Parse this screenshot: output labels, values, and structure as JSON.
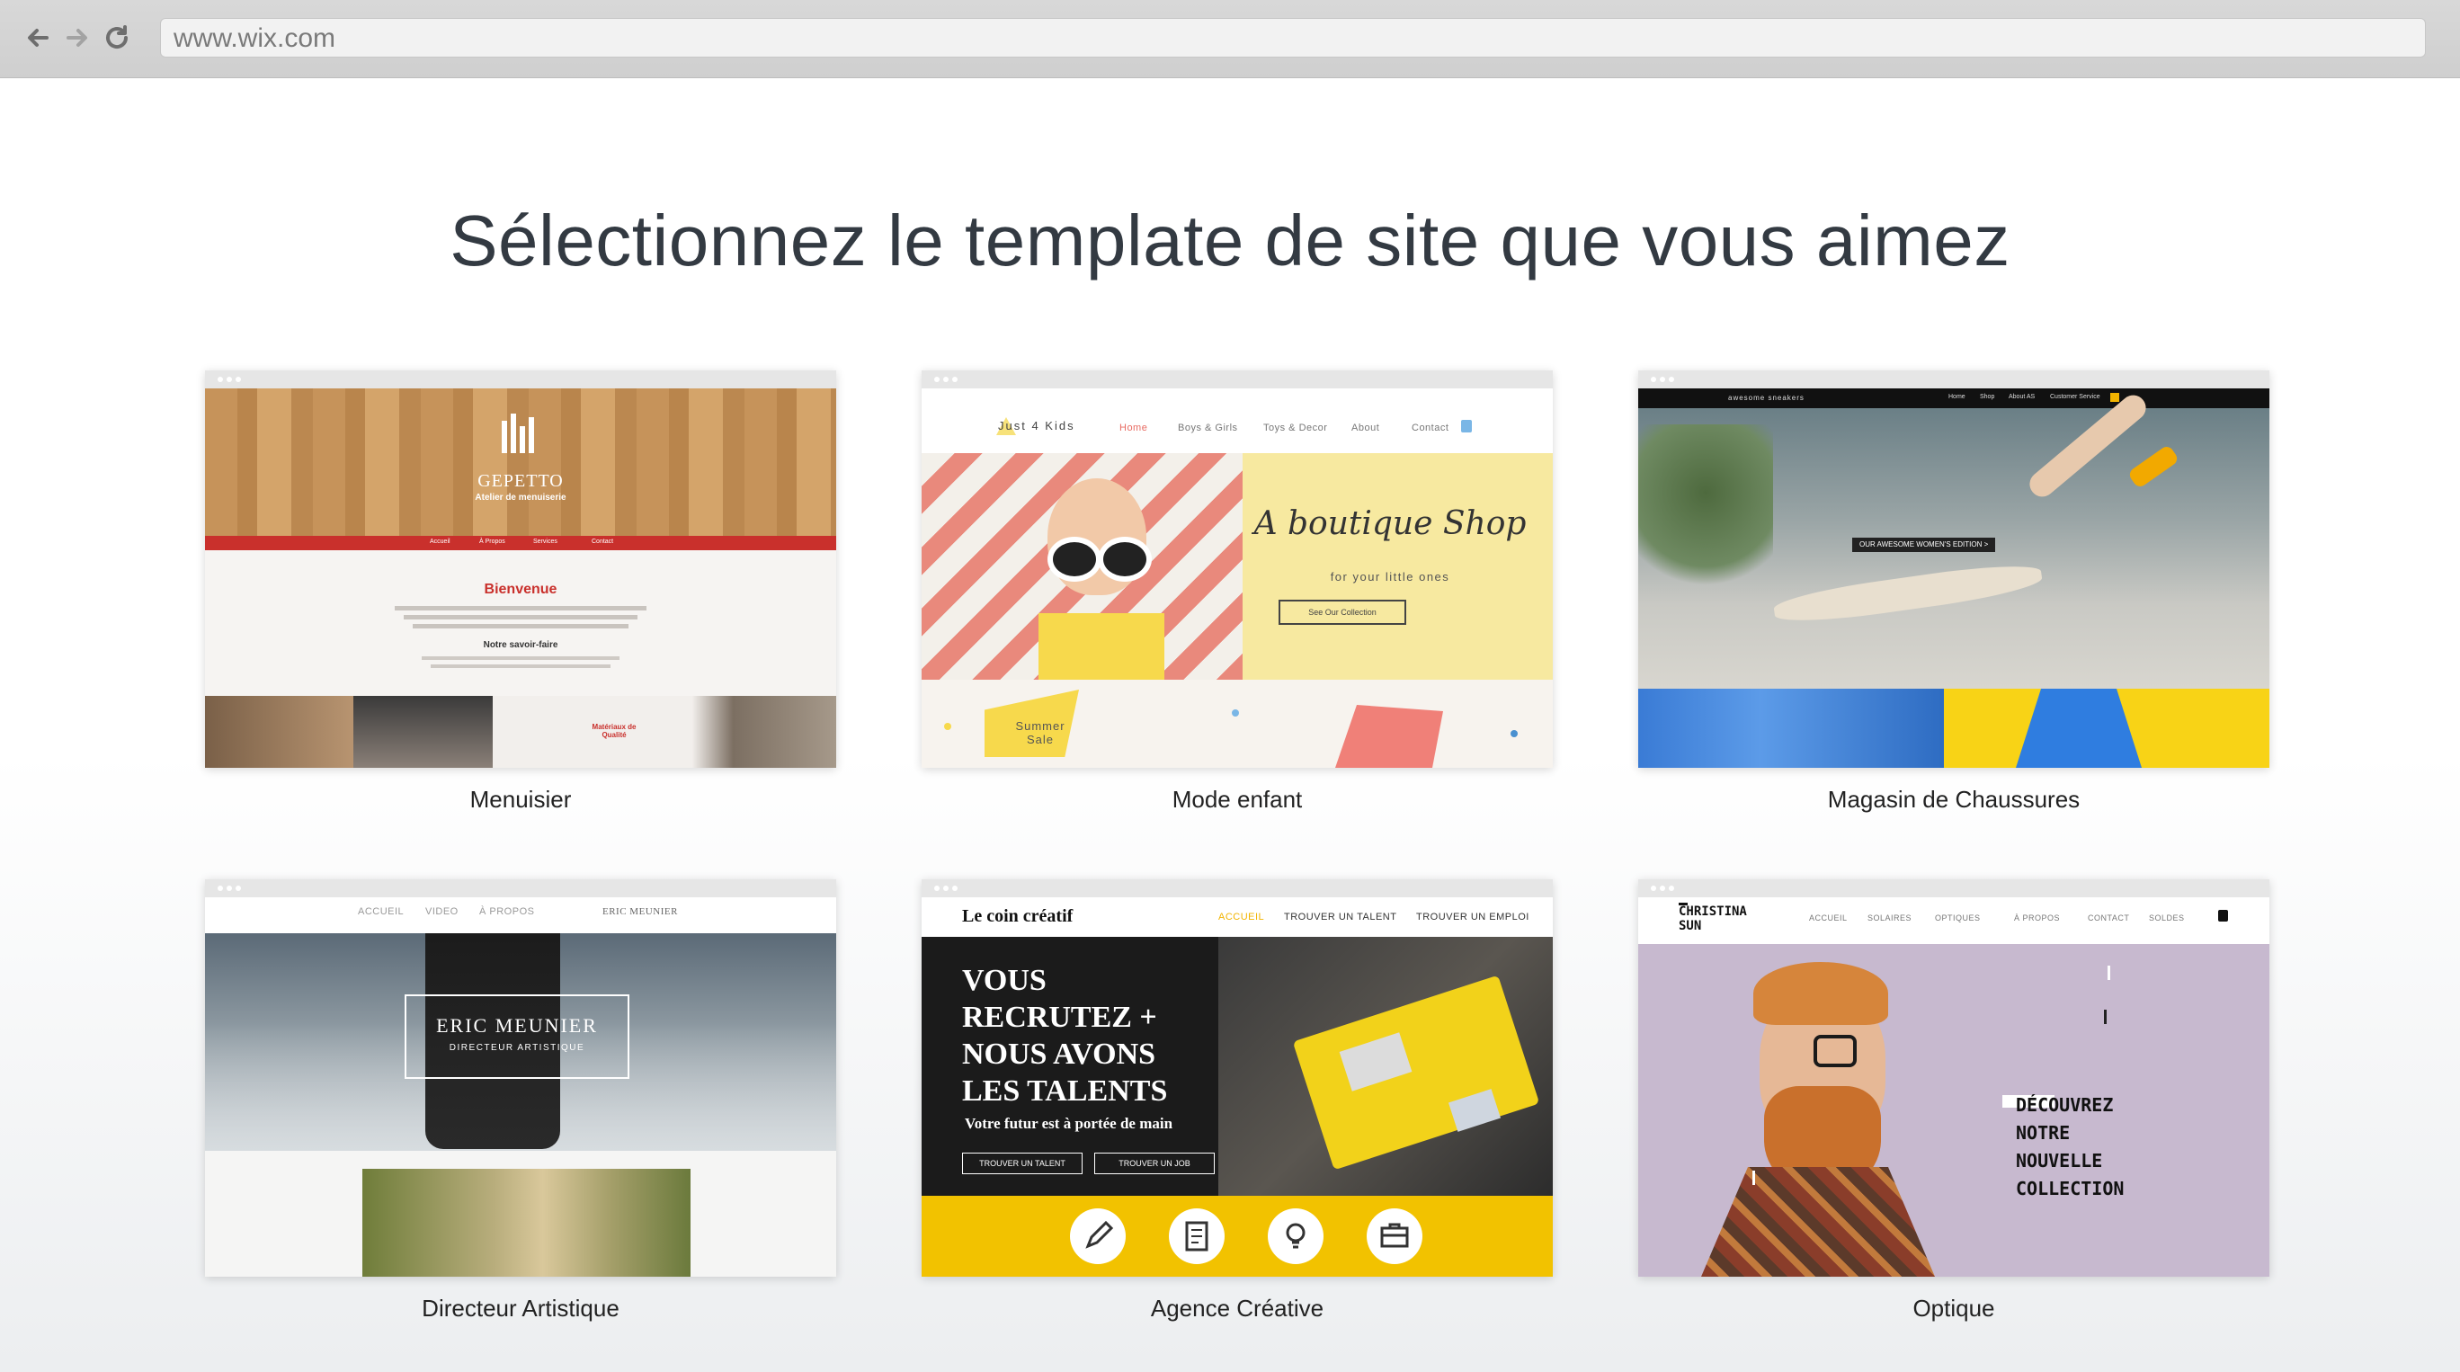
{
  "browser": {
    "url": "www.wix.com"
  },
  "page": {
    "title": "Sélectionnez le template de site que vous aimez"
  },
  "templates": [
    {
      "label": "Menuisier",
      "preview": {
        "brand": "GEPETTO",
        "tagline": "Atelier de menuiserie",
        "nav": [
          "Accueil",
          "À Propos",
          "Services",
          "Contact"
        ],
        "heading": "Bienvenue",
        "subheading": "Notre savoir-faire",
        "badge": "Matériaux de Qualité"
      }
    },
    {
      "label": "Mode enfant",
      "preview": {
        "brand": "Just 4 Kids",
        "nav": [
          "Home",
          "Boys & Girls",
          "Toys & Decor",
          "About",
          "Contact"
        ],
        "headline": "A boutique Shop",
        "sub": "for your little ones",
        "button": "See Our Collection",
        "promo": "Summer Sale"
      }
    },
    {
      "label": "Magasin de Chaussures",
      "preview": {
        "brand": "awesome sneakers",
        "nav": [
          "Home",
          "Shop",
          "About AS",
          "Customer Service"
        ],
        "banner": "OUR AWESOME WOMEN'S EDITION >"
      }
    },
    {
      "label": "Directeur Artistique",
      "preview": {
        "nav": [
          "ACCUEIL",
          "VIDEO",
          "À PROPOS"
        ],
        "brand_small": "ERIC MEUNIER",
        "name": "ERIC MEUNIER",
        "role": "DIRECTEUR ARTISTIQUE"
      }
    },
    {
      "label": "Agence Créative",
      "preview": {
        "brand": "Le coin créatif",
        "nav": [
          "ACCUEIL",
          "TROUVER UN TALENT",
          "TROUVER UN EMPLOI"
        ],
        "headline_lines": [
          "VOUS",
          "RECRUTEZ +",
          "NOUS AVONS",
          "LES TALENTS"
        ],
        "sub": "Votre futur est à portée de main",
        "buttons": [
          "TROUVER UN TALENT",
          "TROUVER UN JOB"
        ]
      }
    },
    {
      "label": "Optique",
      "preview": {
        "brand_lines": [
          "CHRISTINA",
          "SUN"
        ],
        "nav": [
          "ACCUEIL",
          "SOLAIRES",
          "OPTIQUES",
          "À PROPOS",
          "CONTACT",
          "SOLDES"
        ],
        "headline_lines": [
          "DÉCOUVREZ",
          "NOTRE",
          "NOUVELLE",
          "COLLECTION"
        ]
      }
    }
  ],
  "colors": {
    "menuisier_red": "#c9302c",
    "kids_yellow": "#f7e9a0",
    "agency_yellow": "#f2c200",
    "optique_lilac": "#c7b9cf"
  },
  "icons": [
    "back-arrow-icon",
    "forward-arrow-icon",
    "reload-icon",
    "pencil-icon",
    "document-icon",
    "lightbulb-icon",
    "briefcase-icon",
    "cart-icon"
  ]
}
